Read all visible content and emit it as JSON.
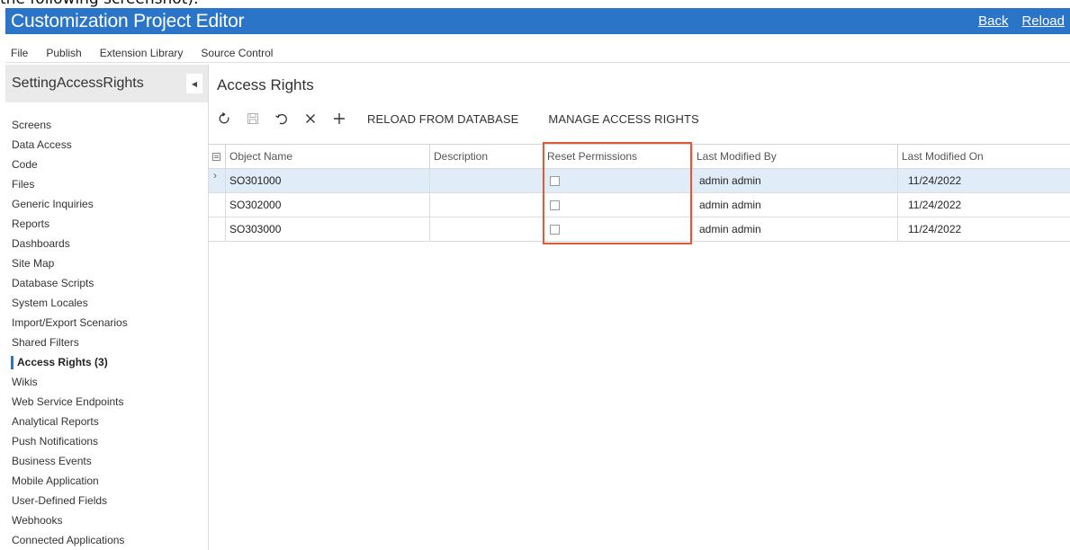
{
  "cut_text": "the following screenshot):",
  "app": {
    "title": "Customization Project Editor",
    "links": {
      "back": "Back",
      "reload": "Reload"
    }
  },
  "menu": {
    "items": [
      "File",
      "Publish",
      "Extension Library",
      "Source Control"
    ]
  },
  "sidebar": {
    "project_name": "SettingAccessRights",
    "active_item": "Access Rights (3)",
    "items": [
      "Screens",
      "Data Access",
      "Code",
      "Files",
      "Generic Inquiries",
      "Reports",
      "Dashboards",
      "Site Map",
      "Database Scripts",
      "System Locales",
      "Import/Export Scenarios",
      "Shared Filters",
      "Access Rights (3)",
      "Wikis",
      "Web Service Endpoints",
      "Analytical Reports",
      "Push Notifications",
      "Business Events",
      "Mobile Application",
      "User-Defined Fields",
      "Webhooks",
      "Connected Applications"
    ],
    "accent_color": "#2a75c8"
  },
  "main": {
    "title": "Access Rights",
    "toolbar": {
      "icons": [
        "refresh-icon",
        "save-icon",
        "undo-icon",
        "delete-icon",
        "add-icon"
      ],
      "reload_from_db": "RELOAD FROM DATABASE",
      "manage_access": "MANAGE ACCESS RIGHTS"
    },
    "grid": {
      "columns": [
        "Object Name",
        "Description",
        "Reset Permissions",
        "Last Modified By",
        "Last Modified On"
      ],
      "rows": [
        {
          "object_name": "SO301000",
          "description": "",
          "reset_permissions": false,
          "last_modified_by": "admin admin",
          "last_modified_on": "11/24/2022"
        },
        {
          "object_name": "SO302000",
          "description": "",
          "reset_permissions": false,
          "last_modified_by": "admin admin",
          "last_modified_on": "11/24/2022"
        },
        {
          "object_name": "SO303000",
          "description": "",
          "reset_permissions": false,
          "last_modified_by": "admin admin",
          "last_modified_on": "11/24/2022"
        }
      ],
      "selected_row": 0,
      "highlight_color": "#e05a3a"
    }
  }
}
